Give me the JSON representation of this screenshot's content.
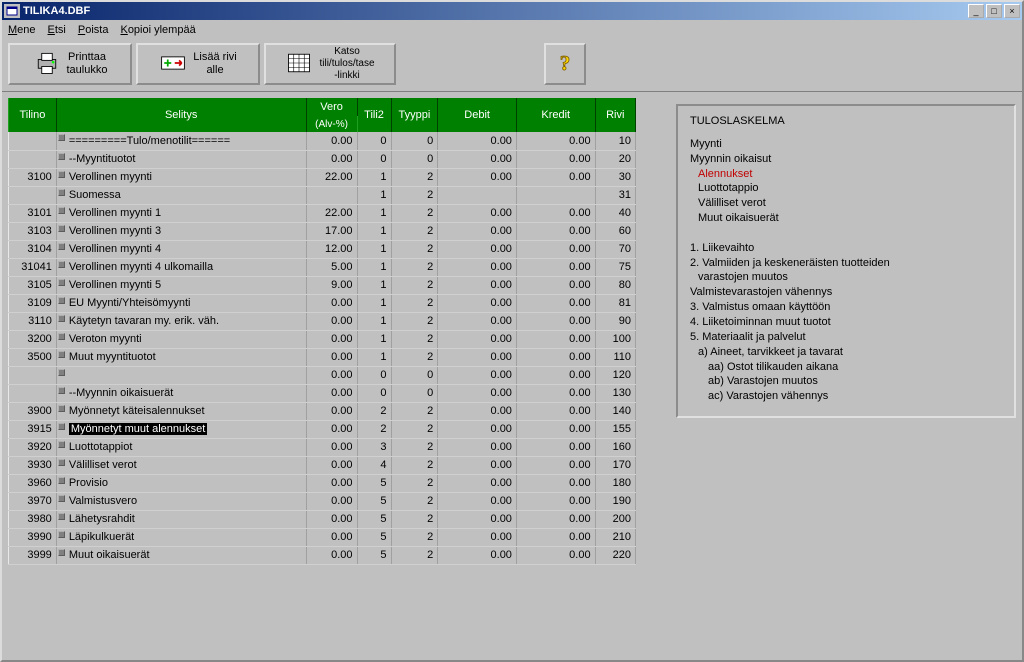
{
  "window": {
    "title": "TILIKA4.DBF"
  },
  "menu": {
    "items": [
      {
        "label": "Mene",
        "accel": "M"
      },
      {
        "label": "Etsi",
        "accel": "E"
      },
      {
        "label": "Poista",
        "accel": "P"
      },
      {
        "label": "Kopioi ylempää",
        "accel": "K"
      }
    ]
  },
  "toolbar": {
    "print": {
      "line1": "Printtaa",
      "line2": "taulukko"
    },
    "addrow": {
      "line1": "Lisää rivi",
      "line2": "alle"
    },
    "link": {
      "line1": "Katso",
      "line2": "tili/tulos/tase",
      "line3": "-linkki"
    },
    "help": {
      "label": "?"
    }
  },
  "columns": {
    "tilino": "Tilino",
    "selitys": "Selitys",
    "vero": "Vero",
    "vero_sub": "(Alv-%)",
    "tili2": "Tili2",
    "tyyppi": "Tyyppi",
    "debit": "Debit",
    "kredit": "Kredit",
    "rivi": "Rivi"
  },
  "rows": [
    {
      "tilino": "",
      "selitys": "=========Tulo/menotilit======",
      "vero": "0.00",
      "tili2": "0",
      "tyyppi": "0",
      "debit": "0.00",
      "kredit": "0.00",
      "rivi": "10"
    },
    {
      "tilino": "",
      "selitys": "--Myyntituotot",
      "vero": "0.00",
      "tili2": "0",
      "tyyppi": "0",
      "debit": "0.00",
      "kredit": "0.00",
      "rivi": "20"
    },
    {
      "tilino": "3100",
      "selitys": "Verollinen myynti",
      "vero": "22.00",
      "tili2": "1",
      "tyyppi": "2",
      "debit": "0.00",
      "kredit": "0.00",
      "rivi": "30"
    },
    {
      "tilino": "",
      "selitys": "Suomessa",
      "vero": "",
      "tili2": "1",
      "tyyppi": "2",
      "debit": "",
      "kredit": "",
      "rivi": "31"
    },
    {
      "tilino": "3101",
      "selitys": "Verollinen myynti 1",
      "vero": "22.00",
      "tili2": "1",
      "tyyppi": "2",
      "debit": "0.00",
      "kredit": "0.00",
      "rivi": "40"
    },
    {
      "tilino": "3103",
      "selitys": "Verollinen myynti 3",
      "vero": "17.00",
      "tili2": "1",
      "tyyppi": "2",
      "debit": "0.00",
      "kredit": "0.00",
      "rivi": "60"
    },
    {
      "tilino": "3104",
      "selitys": "Verollinen myynti 4",
      "vero": "12.00",
      "tili2": "1",
      "tyyppi": "2",
      "debit": "0.00",
      "kredit": "0.00",
      "rivi": "70"
    },
    {
      "tilino": "31041",
      "selitys": "Verollinen myynti 4 ulkomailla",
      "vero": "5.00",
      "tili2": "1",
      "tyyppi": "2",
      "debit": "0.00",
      "kredit": "0.00",
      "rivi": "75"
    },
    {
      "tilino": "3105",
      "selitys": "Verollinen myynti 5",
      "vero": "9.00",
      "tili2": "1",
      "tyyppi": "2",
      "debit": "0.00",
      "kredit": "0.00",
      "rivi": "80"
    },
    {
      "tilino": "3109",
      "selitys": "EU Myynti/Yhteisömyynti",
      "vero": "0.00",
      "tili2": "1",
      "tyyppi": "2",
      "debit": "0.00",
      "kredit": "0.00",
      "rivi": "81"
    },
    {
      "tilino": "3110",
      "selitys": "Käytetyn tavaran my. erik. väh.",
      "vero": "0.00",
      "tili2": "1",
      "tyyppi": "2",
      "debit": "0.00",
      "kredit": "0.00",
      "rivi": "90"
    },
    {
      "tilino": "3200",
      "selitys": "Veroton myynti",
      "vero": "0.00",
      "tili2": "1",
      "tyyppi": "2",
      "debit": "0.00",
      "kredit": "0.00",
      "rivi": "100"
    },
    {
      "tilino": "3500",
      "selitys": "Muut myyntituotot",
      "vero": "0.00",
      "tili2": "1",
      "tyyppi": "2",
      "debit": "0.00",
      "kredit": "0.00",
      "rivi": "110"
    },
    {
      "tilino": "",
      "selitys": "",
      "vero": "0.00",
      "tili2": "0",
      "tyyppi": "0",
      "debit": "0.00",
      "kredit": "0.00",
      "rivi": "120"
    },
    {
      "tilino": "",
      "selitys": "--Myynnin oikaisuerät",
      "vero": "0.00",
      "tili2": "0",
      "tyyppi": "0",
      "debit": "0.00",
      "kredit": "0.00",
      "rivi": "130"
    },
    {
      "tilino": "3900",
      "selitys": "Myönnetyt käteisalennukset",
      "vero": "0.00",
      "tili2": "2",
      "tyyppi": "2",
      "debit": "0.00",
      "kredit": "0.00",
      "rivi": "140"
    },
    {
      "tilino": "3915",
      "selitys": "Myönnetyt muut alennukset",
      "vero": "0.00",
      "tili2": "2",
      "tyyppi": "2",
      "debit": "0.00",
      "kredit": "0.00",
      "rivi": "155",
      "selected": true
    },
    {
      "tilino": "3920",
      "selitys": "Luottotappiot",
      "vero": "0.00",
      "tili2": "3",
      "tyyppi": "2",
      "debit": "0.00",
      "kredit": "0.00",
      "rivi": "160"
    },
    {
      "tilino": "3930",
      "selitys": "Välilliset verot",
      "vero": "0.00",
      "tili2": "4",
      "tyyppi": "2",
      "debit": "0.00",
      "kredit": "0.00",
      "rivi": "170"
    },
    {
      "tilino": "3960",
      "selitys": "Provisio",
      "vero": "0.00",
      "tili2": "5",
      "tyyppi": "2",
      "debit": "0.00",
      "kredit": "0.00",
      "rivi": "180"
    },
    {
      "tilino": "3970",
      "selitys": "Valmistusvero",
      "vero": "0.00",
      "tili2": "5",
      "tyyppi": "2",
      "debit": "0.00",
      "kredit": "0.00",
      "rivi": "190"
    },
    {
      "tilino": "3980",
      "selitys": "Lähetysrahdit",
      "vero": "0.00",
      "tili2": "5",
      "tyyppi": "2",
      "debit": "0.00",
      "kredit": "0.00",
      "rivi": "200"
    },
    {
      "tilino": "3990",
      "selitys": "Läpikulkuerät",
      "vero": "0.00",
      "tili2": "5",
      "tyyppi": "2",
      "debit": "0.00",
      "kredit": "0.00",
      "rivi": "210"
    },
    {
      "tilino": "3999",
      "selitys": "Muut oikaisuerät",
      "vero": "0.00",
      "tili2": "5",
      "tyyppi": "2",
      "debit": "0.00",
      "kredit": "0.00",
      "rivi": "220"
    }
  ],
  "side": {
    "heading": "TULOSLASKELMA",
    "lines": [
      {
        "text": "Myynti"
      },
      {
        "text": "Myynnin oikaisut"
      },
      {
        "text": "Alennukset",
        "class": "red",
        "indent": 1
      },
      {
        "text": "Luottotappio",
        "indent": 1
      },
      {
        "text": "Välilliset verot",
        "indent": 1
      },
      {
        "text": "Muut oikaisuerät",
        "indent": 1
      },
      {
        "text": "",
        "blank": true
      },
      {
        "text": "1. Liikevaihto"
      },
      {
        "text": "2. Valmiiden ja keskeneräisten tuotteiden"
      },
      {
        "text": "varastojen muutos",
        "indent": 1
      },
      {
        "text": "Valmistevarastojen vähennys"
      },
      {
        "text": "3. Valmistus omaan käyttöön"
      },
      {
        "text": "4. Liiketoiminnan muut tuotot"
      },
      {
        "text": "5. Materiaalit ja palvelut"
      },
      {
        "text": "a) Aineet, tarvikkeet ja tavarat",
        "indent": 1
      },
      {
        "text": "aa) Ostot tilikauden aikana",
        "indent": 2
      },
      {
        "text": "ab) Varastojen muutos",
        "indent": 2
      },
      {
        "text": "ac) Varastojen vähennys",
        "indent": 2
      }
    ]
  }
}
